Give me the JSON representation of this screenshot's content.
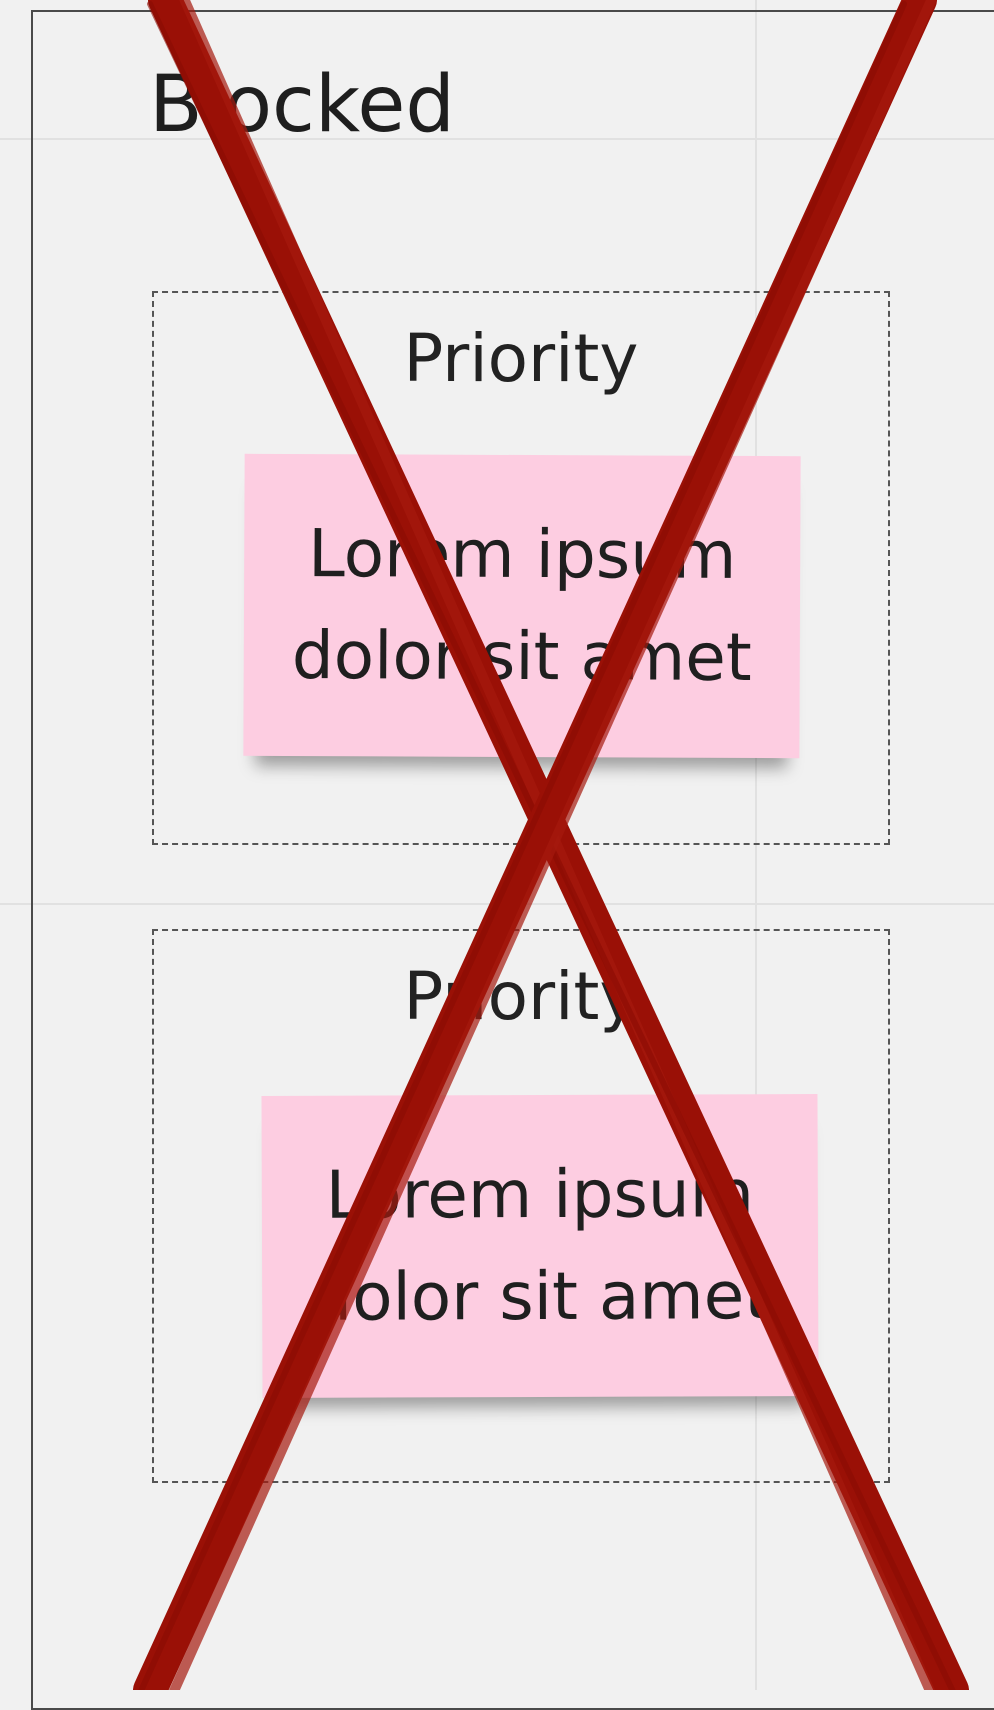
{
  "board": {
    "column_title": "Blocked",
    "groups": [
      {
        "label": "Priority",
        "note": {
          "line1": "Lorem ipsum",
          "line2": "dolor sit amet"
        }
      },
      {
        "label": "Priority",
        "note": {
          "line1": "Lorem ipsum",
          "line2": "dolor sit amet"
        }
      }
    ]
  },
  "overlay": {
    "icon": "cross-out-icon",
    "color": "#9a1006"
  },
  "colors": {
    "background": "#f1f1f1",
    "sticky_note": "#fdcde1"
  }
}
